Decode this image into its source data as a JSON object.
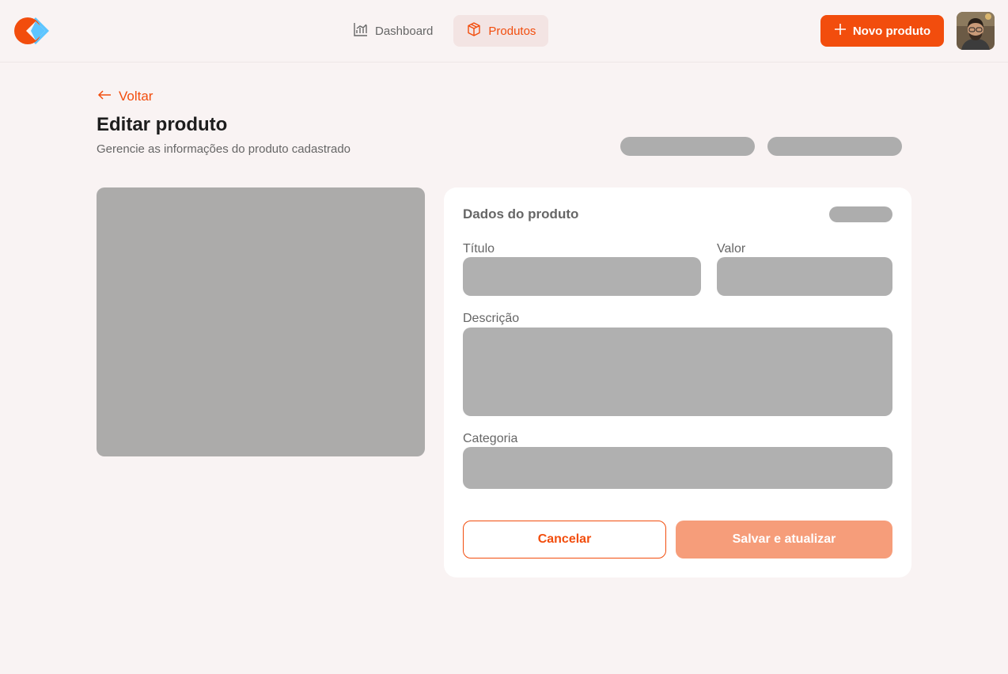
{
  "header": {
    "nav": [
      {
        "label": "Dashboard",
        "icon": "chart-icon",
        "active": false
      },
      {
        "label": "Produtos",
        "icon": "package-icon",
        "active": true
      }
    ],
    "new_product_label": "Novo produto"
  },
  "page": {
    "back_label": "Voltar",
    "title": "Editar produto",
    "subtitle": "Gerencie as informações do produto cadastrado"
  },
  "form": {
    "title": "Dados do produto",
    "labels": {
      "title": "Título",
      "value": "Valor",
      "description": "Descrição",
      "category": "Categoria"
    },
    "cancel_label": "Cancelar",
    "save_label": "Salvar e atualizar"
  },
  "colors": {
    "accent": "#F24D0D",
    "accent_light": "#F69D7A",
    "background": "#F9F3F3",
    "skeleton": "#ADADAD",
    "logo_blue": "#5EC5FF"
  }
}
